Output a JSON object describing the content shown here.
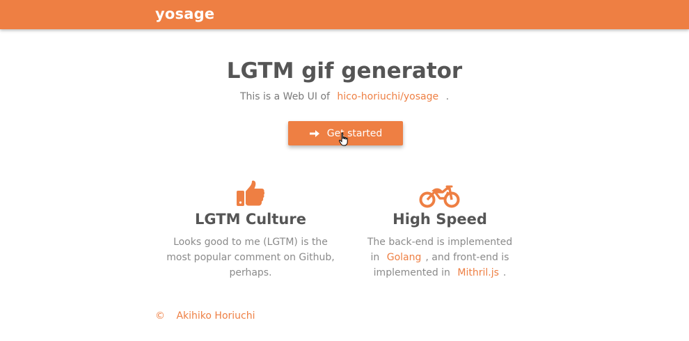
{
  "header": {
    "brand": "yosage"
  },
  "hero": {
    "title": "LGTM gif generator",
    "subtitle_prefix": "This is a Web UI of",
    "subtitle_link": "hico-horiuchi/yosage",
    "subtitle_suffix": ".",
    "cta_label": "Get started"
  },
  "features": [
    {
      "icon": "thumbs-up-icon",
      "title": "LGTM Culture",
      "text": "Looks good to me (LGTM) is the most popular comment on Github, perhaps."
    },
    {
      "icon": "motorcycle-icon",
      "title": "High Speed",
      "text_1": "The back-end is implemented",
      "text_2": "in",
      "link_1": "Golang",
      "text_3": ", and front-end is",
      "text_4": "implemented in",
      "link_2": "Mithril.js",
      "text_5": "."
    }
  ],
  "footer": {
    "copyright_symbol": "©",
    "author": "Akihiko Horiuchi"
  },
  "colors": {
    "accent": "#ee7f43",
    "text": "#555555",
    "muted": "#8a8a8a"
  }
}
